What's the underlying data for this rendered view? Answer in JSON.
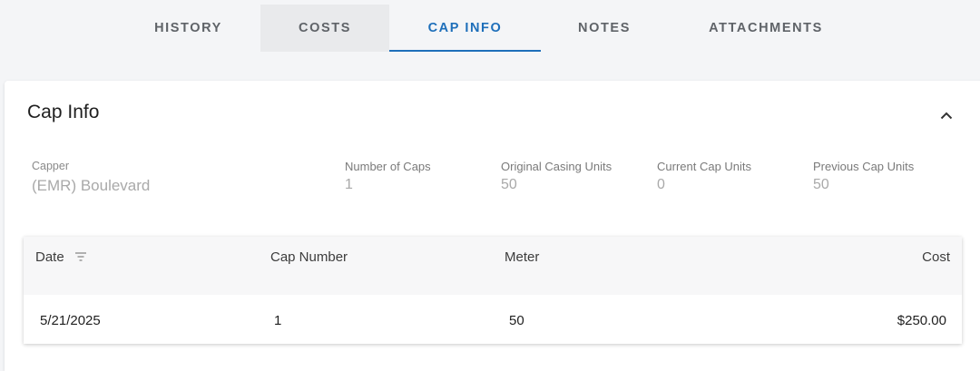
{
  "tabs": [
    {
      "label": "HISTORY"
    },
    {
      "label": "COSTS"
    },
    {
      "label": "CAP INFO"
    },
    {
      "label": "NOTES"
    },
    {
      "label": "ATTACHMENTS"
    }
  ],
  "active_tab": "CAP INFO",
  "colors": {
    "accent": "#1e6fba",
    "background": "#f4f5f7"
  },
  "cap_info": {
    "title": "Cap Info",
    "fields": {
      "capper": {
        "label": "Capper",
        "value": "(EMR) Boulevard"
      },
      "number_of_caps": {
        "label": "Number of Caps",
        "value": "1"
      },
      "original_casing_units": {
        "label": "Original Casing Units",
        "value": "50"
      },
      "current_cap_units": {
        "label": "Current Cap Units",
        "value": "0"
      },
      "previous_cap_units": {
        "label": "Previous Cap Units",
        "value": "50"
      }
    },
    "table": {
      "columns": {
        "date": "Date",
        "cap_number": "Cap Number",
        "meter": "Meter",
        "cost": "Cost"
      },
      "rows": [
        {
          "date": "5/21/2025",
          "cap_number": "1",
          "meter": "50",
          "cost": "$250.00"
        }
      ]
    }
  },
  "icons": {
    "collapse": "chevron-up-icon",
    "filter": "filter-icon"
  }
}
